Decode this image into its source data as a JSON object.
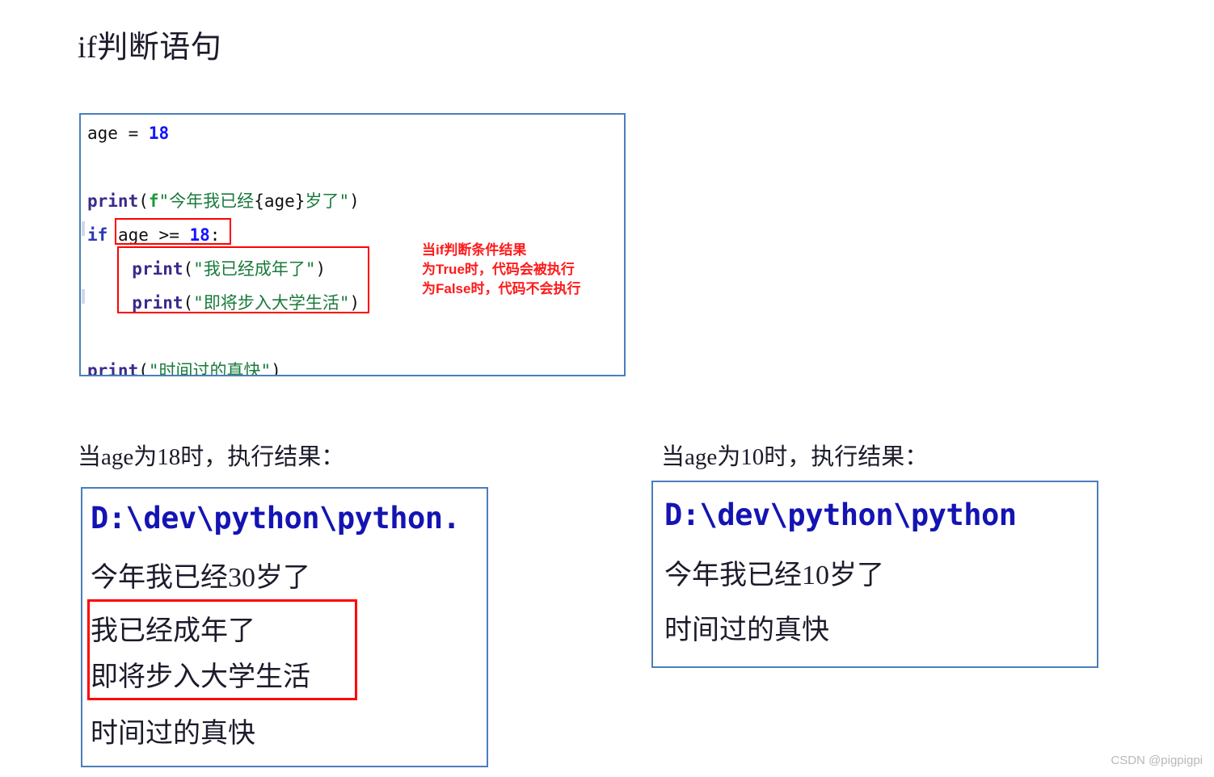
{
  "page": {
    "title": "if判断语句",
    "watermark": "CSDN @pigpigpi"
  },
  "code_block": {
    "language": "python",
    "border_color": "#4a7ebb",
    "lines": {
      "assign_var": "age",
      "assign_op": "=",
      "assign_value": "18",
      "print1_func": "print",
      "print1_open": "(",
      "print1_fprefix": "f",
      "print1_quote_open": "\"",
      "print1_text_a": "今年我已经",
      "print1_brace_open": "{",
      "print1_expr": "age",
      "print1_brace_close": "}",
      "print1_text_b": "岁了",
      "print1_quote_close": "\"",
      "print1_close": ")",
      "if_keyword": "if",
      "if_cond_left": "age",
      "if_cond_op": ">=",
      "if_cond_right": "18",
      "if_colon": ":",
      "print2_func": "print",
      "print2_open": "(",
      "print2_str": "\"我已经成年了\"",
      "print2_close": ")",
      "print3_func": "print",
      "print3_open": "(",
      "print3_str": "\"即将步入大学生活\"",
      "print3_close": ")",
      "print4_func": "print",
      "print4_open": "(",
      "print4_str": "\"时间过的真快\"",
      "print4_close": ")"
    },
    "highlight_boxes": [
      {
        "name": "condition-highlight",
        "color": "#ff0000"
      },
      {
        "name": "if-body-highlight",
        "color": "#ff0000"
      }
    ]
  },
  "annotation": {
    "color": "#ff1a1a",
    "line1": "当if判断条件结果",
    "line2": "为True时，代码会被执行",
    "line3": "为False时，代码不会执行"
  },
  "results": {
    "left": {
      "caption": "当age为18时，执行结果：",
      "output_lines": [
        "D:\\dev\\python\\python.",
        "今年我已经30岁了",
        "我已经成年了",
        "即将步入大学生活",
        "时间过的真快"
      ],
      "highlight_box": {
        "name": "if-branch-output-highlight",
        "color": "#ff0000"
      }
    },
    "right": {
      "caption": "当age为10时，执行结果：",
      "output_lines": [
        "D:\\dev\\python\\python",
        "今年我已经10岁了",
        "时间过的真快"
      ]
    }
  }
}
